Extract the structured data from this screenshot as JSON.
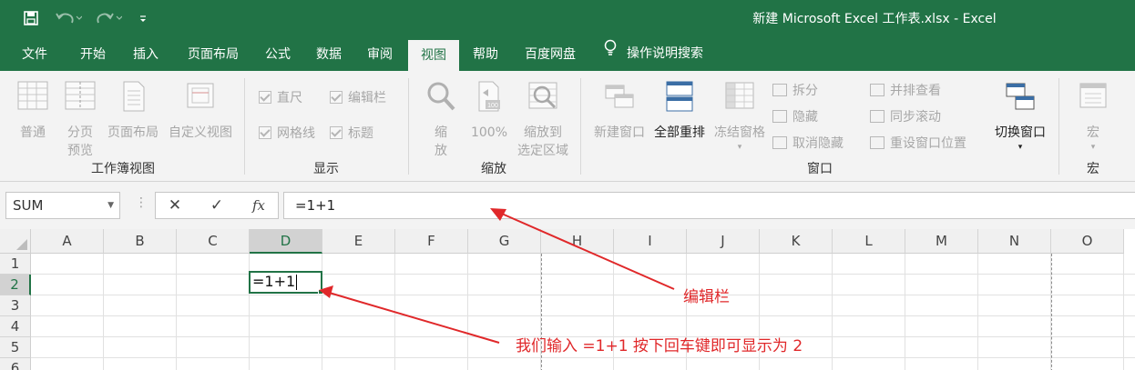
{
  "window": {
    "title": "新建 Microsoft Excel 工作表.xlsx - Excel"
  },
  "quick_access": {
    "icons": [
      "save-icon",
      "undo-icon",
      "redo-icon",
      "customize-icon"
    ]
  },
  "tabs": [
    {
      "label": "文件",
      "active": false
    },
    {
      "label": "开始",
      "active": false
    },
    {
      "label": "插入",
      "active": false
    },
    {
      "label": "页面布局",
      "active": false
    },
    {
      "label": "公式",
      "active": false
    },
    {
      "label": "数据",
      "active": false
    },
    {
      "label": "审阅",
      "active": false
    },
    {
      "label": "视图",
      "active": true
    },
    {
      "label": "帮助",
      "active": false
    },
    {
      "label": "百度网盘",
      "active": false
    }
  ],
  "tell_me": {
    "label": "操作说明搜索",
    "icon": "lightbulb-icon"
  },
  "ribbon": {
    "workbook_views": {
      "group_label": "工作簿视图",
      "normal": "普通",
      "page_break_1": "分页",
      "page_break_2": "预览",
      "page_layout": "页面布局",
      "custom_views": "自定义视图"
    },
    "show": {
      "group_label": "显示",
      "ruler": "直尺",
      "formula_bar": "编辑栏",
      "gridlines": "网格线",
      "headings": "标题"
    },
    "zoom": {
      "group_label": "缩放",
      "zoom_1": "缩",
      "zoom_2": "放",
      "zoom_100": "100%",
      "zoom_sel_1": "缩放到",
      "zoom_sel_2": "选定区域"
    },
    "window": {
      "group_label": "窗口",
      "new_window": "新建窗口",
      "arrange_all": "全部重排",
      "freeze_panes": "冻结窗格",
      "split": "拆分",
      "hide": "隐藏",
      "unhide": "取消隐藏",
      "side_by_side": "并排查看",
      "sync_scroll": "同步滚动",
      "reset_position": "重设窗口位置",
      "switch_windows": "切换窗口"
    },
    "macros": {
      "group_label": "宏",
      "macros": "宏"
    }
  },
  "formula_bar": {
    "name_box": "SUM",
    "cancel_icon": "✕",
    "enter_icon": "✓",
    "fx_label": "fx",
    "formula": "=1+1"
  },
  "sheet": {
    "columns": [
      "A",
      "B",
      "C",
      "D",
      "E",
      "F",
      "G",
      "H",
      "I",
      "J",
      "K",
      "L",
      "M",
      "N",
      "O"
    ],
    "selected_column": "D",
    "rows": [
      "1",
      "2",
      "3",
      "4",
      "5",
      "6"
    ],
    "selected_row": "2",
    "active_cell": {
      "ref": "D2",
      "value": "=1+1"
    }
  },
  "annotations": {
    "formula_bar_note": "编辑栏",
    "cell_note": "我们输入 =1+1 按下回车键即可显示为 2",
    "color": "#e0282a"
  },
  "theme": {
    "accent": "#217346"
  }
}
